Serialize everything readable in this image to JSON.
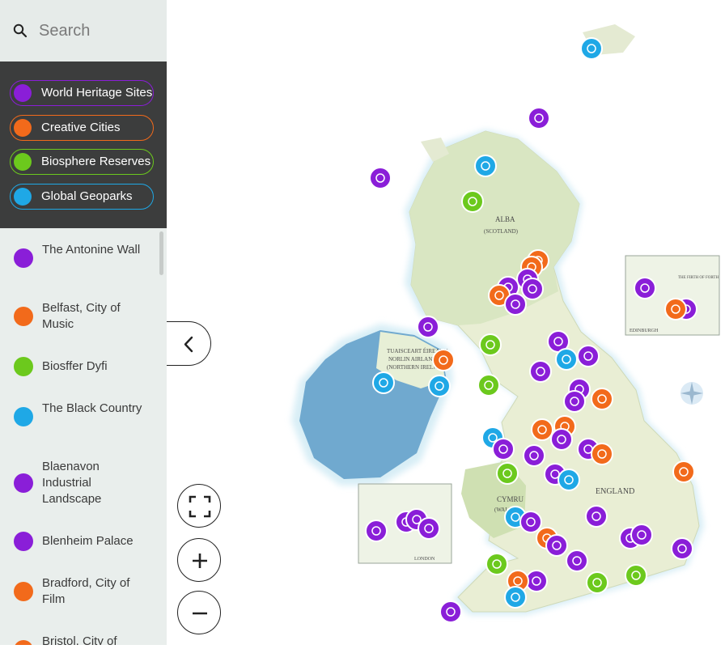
{
  "search": {
    "placeholder": "Search"
  },
  "filters": [
    {
      "label": "World Heritage Sites",
      "color": "#8a1ed8",
      "icon": "building-icon"
    },
    {
      "label": "Creative Cities",
      "color": "#f26a1b",
      "icon": "city-icon"
    },
    {
      "label": "Biosphere Reserves",
      "color": "#6cc91d",
      "icon": "tree-icon"
    },
    {
      "label": "Global Geoparks",
      "color": "#1fa8e6",
      "icon": "ammonite-icon"
    }
  ],
  "sites": [
    {
      "name": "The Antonine Wall",
      "type": "World Heritage Sites"
    },
    {
      "name": "Belfast, City of Music",
      "type": "Creative Cities"
    },
    {
      "name": "Biosffer Dyfi",
      "type": "Biosphere Reserves"
    },
    {
      "name": "The Black Country",
      "type": "Global Geoparks"
    },
    {
      "name": "Blaenavon Industrial Landscape",
      "type": "World Heritage Sites"
    },
    {
      "name": "Blenheim Palace",
      "type": "World Heritage Sites"
    },
    {
      "name": "Bradford, City of Film",
      "type": "Creative Cities"
    },
    {
      "name": "Bristol, City of",
      "type": "Creative Cities"
    }
  ],
  "map_labels": {
    "scotland": "ALBA",
    "scotland_sub": "(SCOTLAND)",
    "n_ireland_1": "TUAISCEART ÉIREANN",
    "n_ireland_2": "NORLIN AIRLANN",
    "n_ireland_3": "(NORTHERN IRELAND)",
    "wales": "CYMRU",
    "wales_sub": "(WALES)",
    "england": "ENGLAND",
    "london": "LONDON",
    "edinburgh": "EDINBURGH",
    "firth": "THE FIRTH OF FORTH"
  },
  "controls": {
    "fullscreen": "fullscreen",
    "zoom_in": "+",
    "zoom_out": "−"
  }
}
